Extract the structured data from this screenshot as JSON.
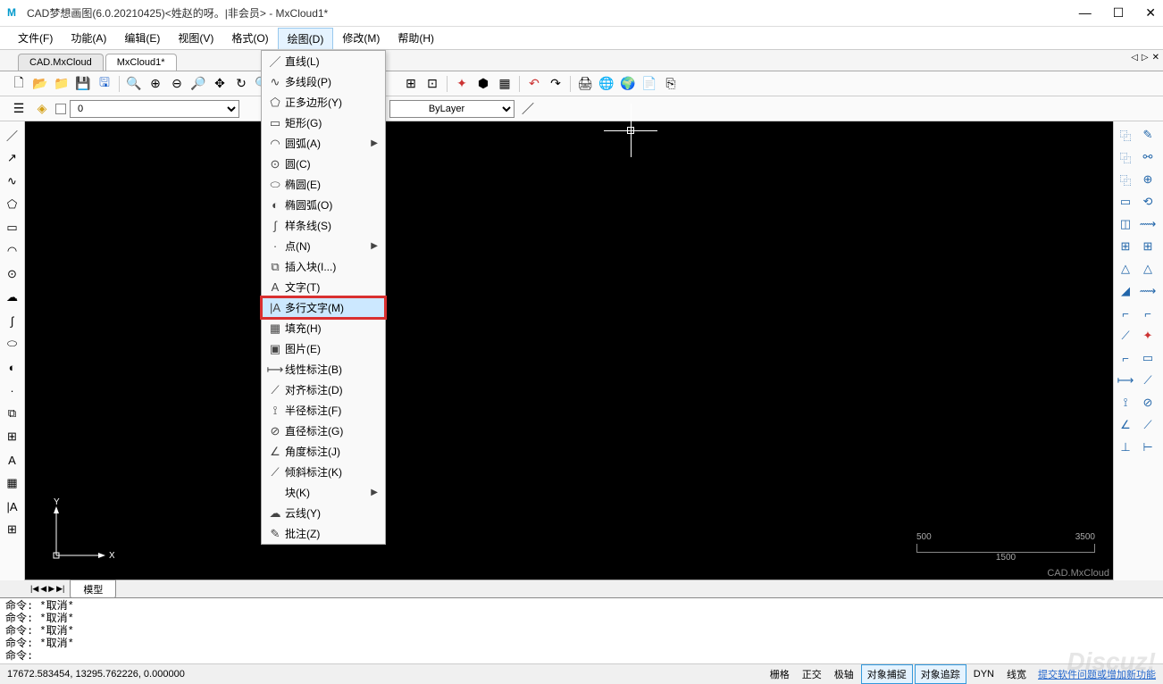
{
  "window": {
    "title": "CAD梦想画图(6.0.20210425)<姓赵的呀。|非会员> - MxCloud1*"
  },
  "menubar": {
    "items": [
      "文件(F)",
      "功能(A)",
      "编辑(E)",
      "视图(V)",
      "格式(O)",
      "绘图(D)",
      "修改(M)",
      "帮助(H)"
    ]
  },
  "tabs": {
    "items": [
      "CAD.MxCloud",
      "MxCloud1*"
    ],
    "active": 1
  },
  "layer_row": {
    "layer": "0",
    "bylayer": "ByLayer"
  },
  "dropdown": {
    "items": [
      {
        "icon": "／",
        "label": "直线(L)",
        "sub": false
      },
      {
        "icon": "∿",
        "label": "多线段(P)",
        "sub": false
      },
      {
        "icon": "⬠",
        "label": "正多边形(Y)",
        "sub": false
      },
      {
        "icon": "▭",
        "label": "矩形(G)",
        "sub": false
      },
      {
        "icon": "◠",
        "label": "圆弧(A)",
        "sub": true
      },
      {
        "icon": "⊙",
        "label": "圆(C)",
        "sub": false
      },
      {
        "icon": "⬭",
        "label": "椭圆(E)",
        "sub": false
      },
      {
        "icon": "◐",
        "label": "椭圆弧(O)",
        "sub": false
      },
      {
        "icon": "∫",
        "label": "样条线(S)",
        "sub": false
      },
      {
        "icon": "·",
        "label": "点(N)",
        "sub": true
      },
      {
        "icon": "⧉",
        "label": "插入块(I...)",
        "sub": false
      },
      {
        "icon": "A",
        "label": "文字(T)",
        "sub": false
      },
      {
        "icon": "|A",
        "label": "多行文字(M)",
        "sub": false,
        "hl": true
      },
      {
        "icon": "▦",
        "label": "填充(H)",
        "sub": false
      },
      {
        "icon": "▣",
        "label": "图片(E)",
        "sub": false
      },
      {
        "icon": "⟼",
        "label": "线性标注(B)",
        "sub": false
      },
      {
        "icon": "⟋",
        "label": "对齐标注(D)",
        "sub": false
      },
      {
        "icon": "⟟",
        "label": "半径标注(F)",
        "sub": false
      },
      {
        "icon": "⊘",
        "label": "直径标注(G)",
        "sub": false
      },
      {
        "icon": "∠",
        "label": "角度标注(J)",
        "sub": false
      },
      {
        "icon": "⟋",
        "label": "倾斜标注(K)",
        "sub": false
      },
      {
        "icon": "",
        "label": "块(K)",
        "sub": true
      },
      {
        "icon": "☁",
        "label": "云线(Y)",
        "sub": false
      },
      {
        "icon": "✎",
        "label": "批注(Z)",
        "sub": false
      }
    ]
  },
  "command": {
    "lines": [
      "命令:  *取消*",
      "命令:  *取消*",
      "命令:  *取消*",
      "命令:  *取消*",
      "命令:"
    ]
  },
  "statusbar": {
    "coords": "17672.583454,  13295.762226,  0.000000",
    "items": [
      {
        "label": "栅格",
        "on": false
      },
      {
        "label": "正交",
        "on": false
      },
      {
        "label": "极轴",
        "on": false
      },
      {
        "label": "对象捕捉",
        "on": true
      },
      {
        "label": "对象追踪",
        "on": true
      },
      {
        "label": "DYN",
        "on": false
      },
      {
        "label": "线宽",
        "on": false
      }
    ],
    "suggest": "提交软件问题或增加新功能"
  },
  "model_tab": "模型",
  "scale": {
    "a": "500",
    "b": "3500",
    "c": "1500"
  },
  "watermark": "Discuz!",
  "brand": "CAD.MxCloud"
}
